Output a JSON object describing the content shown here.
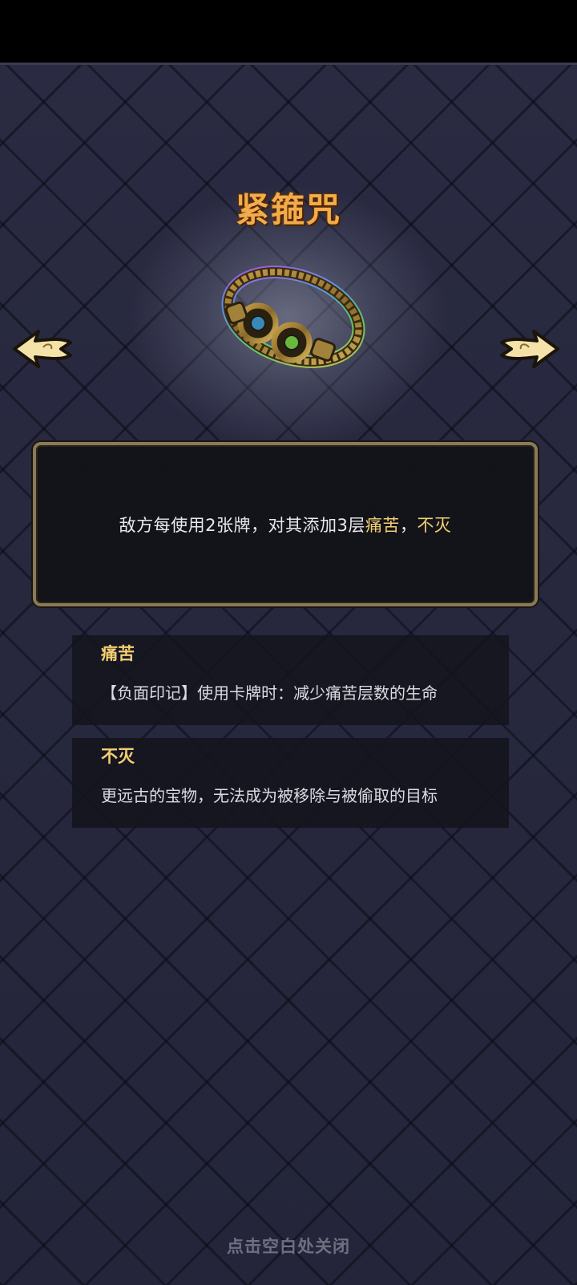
{
  "relic": {
    "name": "紧箍咒",
    "icon": "golden-ring-relic-icon"
  },
  "nav": {
    "prev_icon": "arrow-left-icon",
    "next_icon": "arrow-right-icon"
  },
  "description": {
    "prefix": "敌方每使用2张牌，对其添加3层",
    "keyword1": "痛苦",
    "separator": "，",
    "keyword2": "不灭"
  },
  "keywords": [
    {
      "title": "痛苦",
      "text": "【负面印记】使用卡牌时：减少痛苦层数的生命"
    },
    {
      "title": "不灭",
      "text": "更远古的宝物，无法成为被移除与被偷取的目标"
    }
  ],
  "close_hint": "点击空白处关闭",
  "colors": {
    "title": "#f2ac4b",
    "keyword": "#f2cf72",
    "background": "#25263a",
    "frame": "#8a7a58"
  }
}
